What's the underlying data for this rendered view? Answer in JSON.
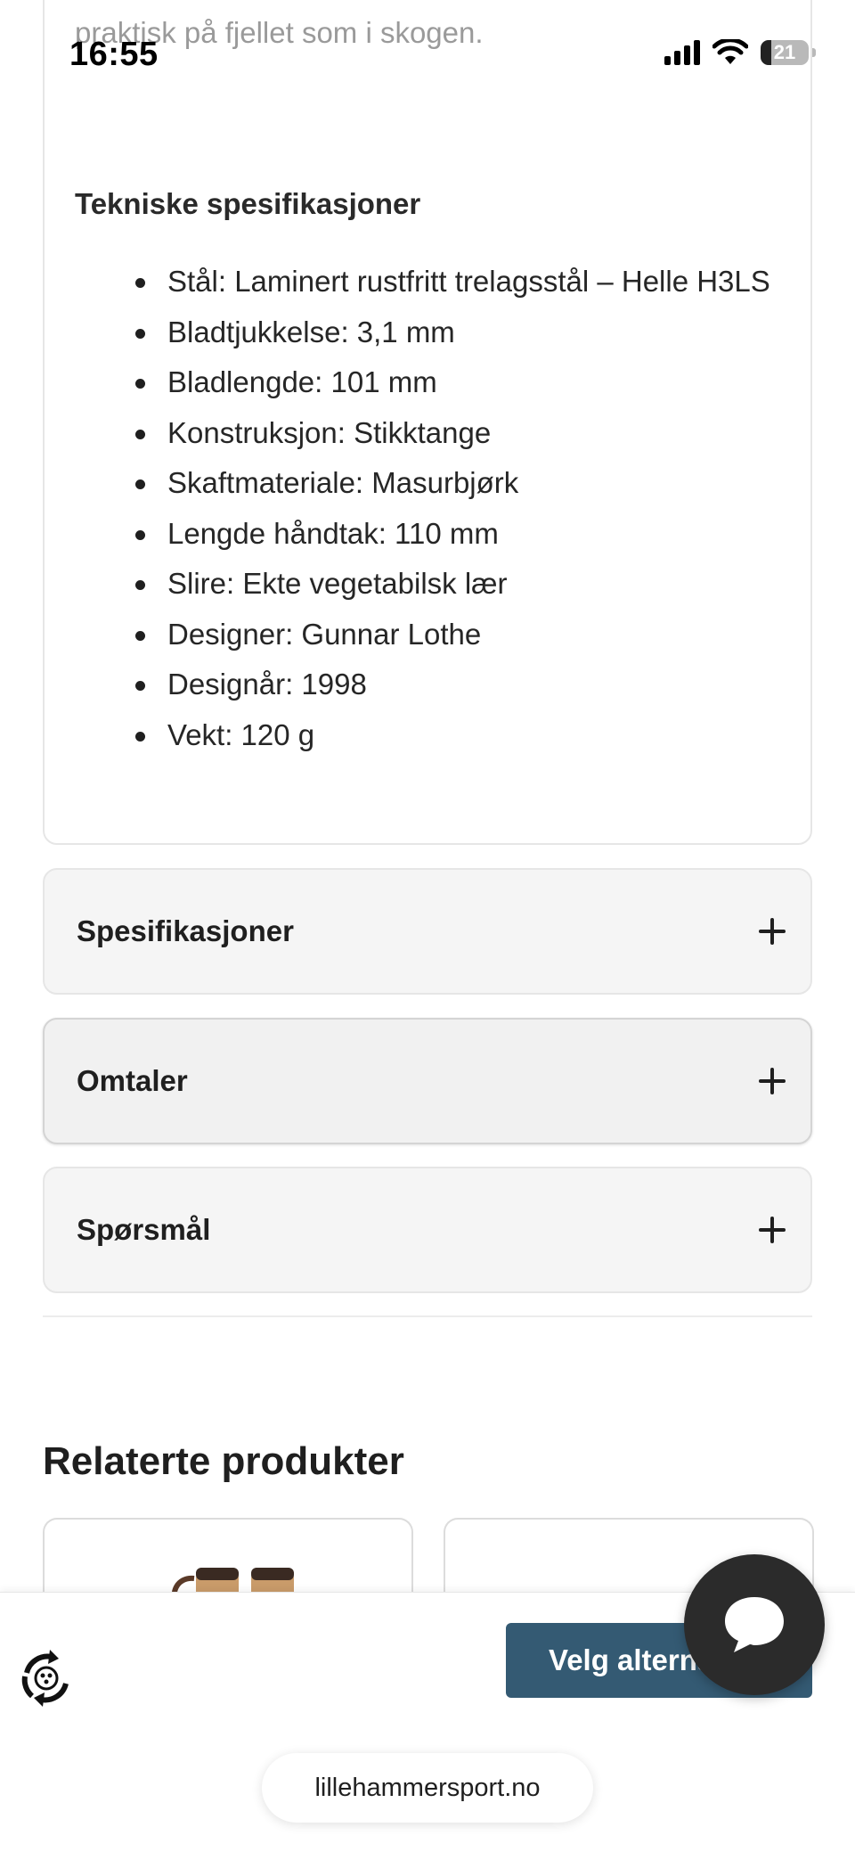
{
  "status_bar": {
    "time": "16:55",
    "battery_level": "21",
    "icons": [
      "signal-icon",
      "wifi-icon",
      "battery-icon"
    ]
  },
  "description": {
    "faded_text": "praktisk på fjellet som i skogen.",
    "specs_heading": "Tekniske spesifikasjoner",
    "specs": [
      "Stål: Laminert rustfritt trelagsstål – Helle H3LS",
      "Bladtjukkelse: 3,1 mm",
      "Bladlengde: 101 mm",
      "Konstruksjon: Stikktange",
      "Skaftmateriale: Masurbjørk",
      "Lengde håndtak: 110 mm",
      "Slire: Ekte vegetabilsk lær",
      "Designer: Gunnar Lothe",
      "Designår: 1998",
      "Vekt: 120 g"
    ]
  },
  "accordions": [
    {
      "label": "Spesifikasjoner"
    },
    {
      "label": "Omtaler"
    },
    {
      "label": "Spørsmål"
    }
  ],
  "related": {
    "title": "Relaterte produkter"
  },
  "bottom_bar": {
    "button_label": "Velg alternativer",
    "url": "lillehammersport.no"
  },
  "colors": {
    "button": "#345a73",
    "chat": "#2b2b2b",
    "accordion_bg": "#f5f5f5"
  }
}
